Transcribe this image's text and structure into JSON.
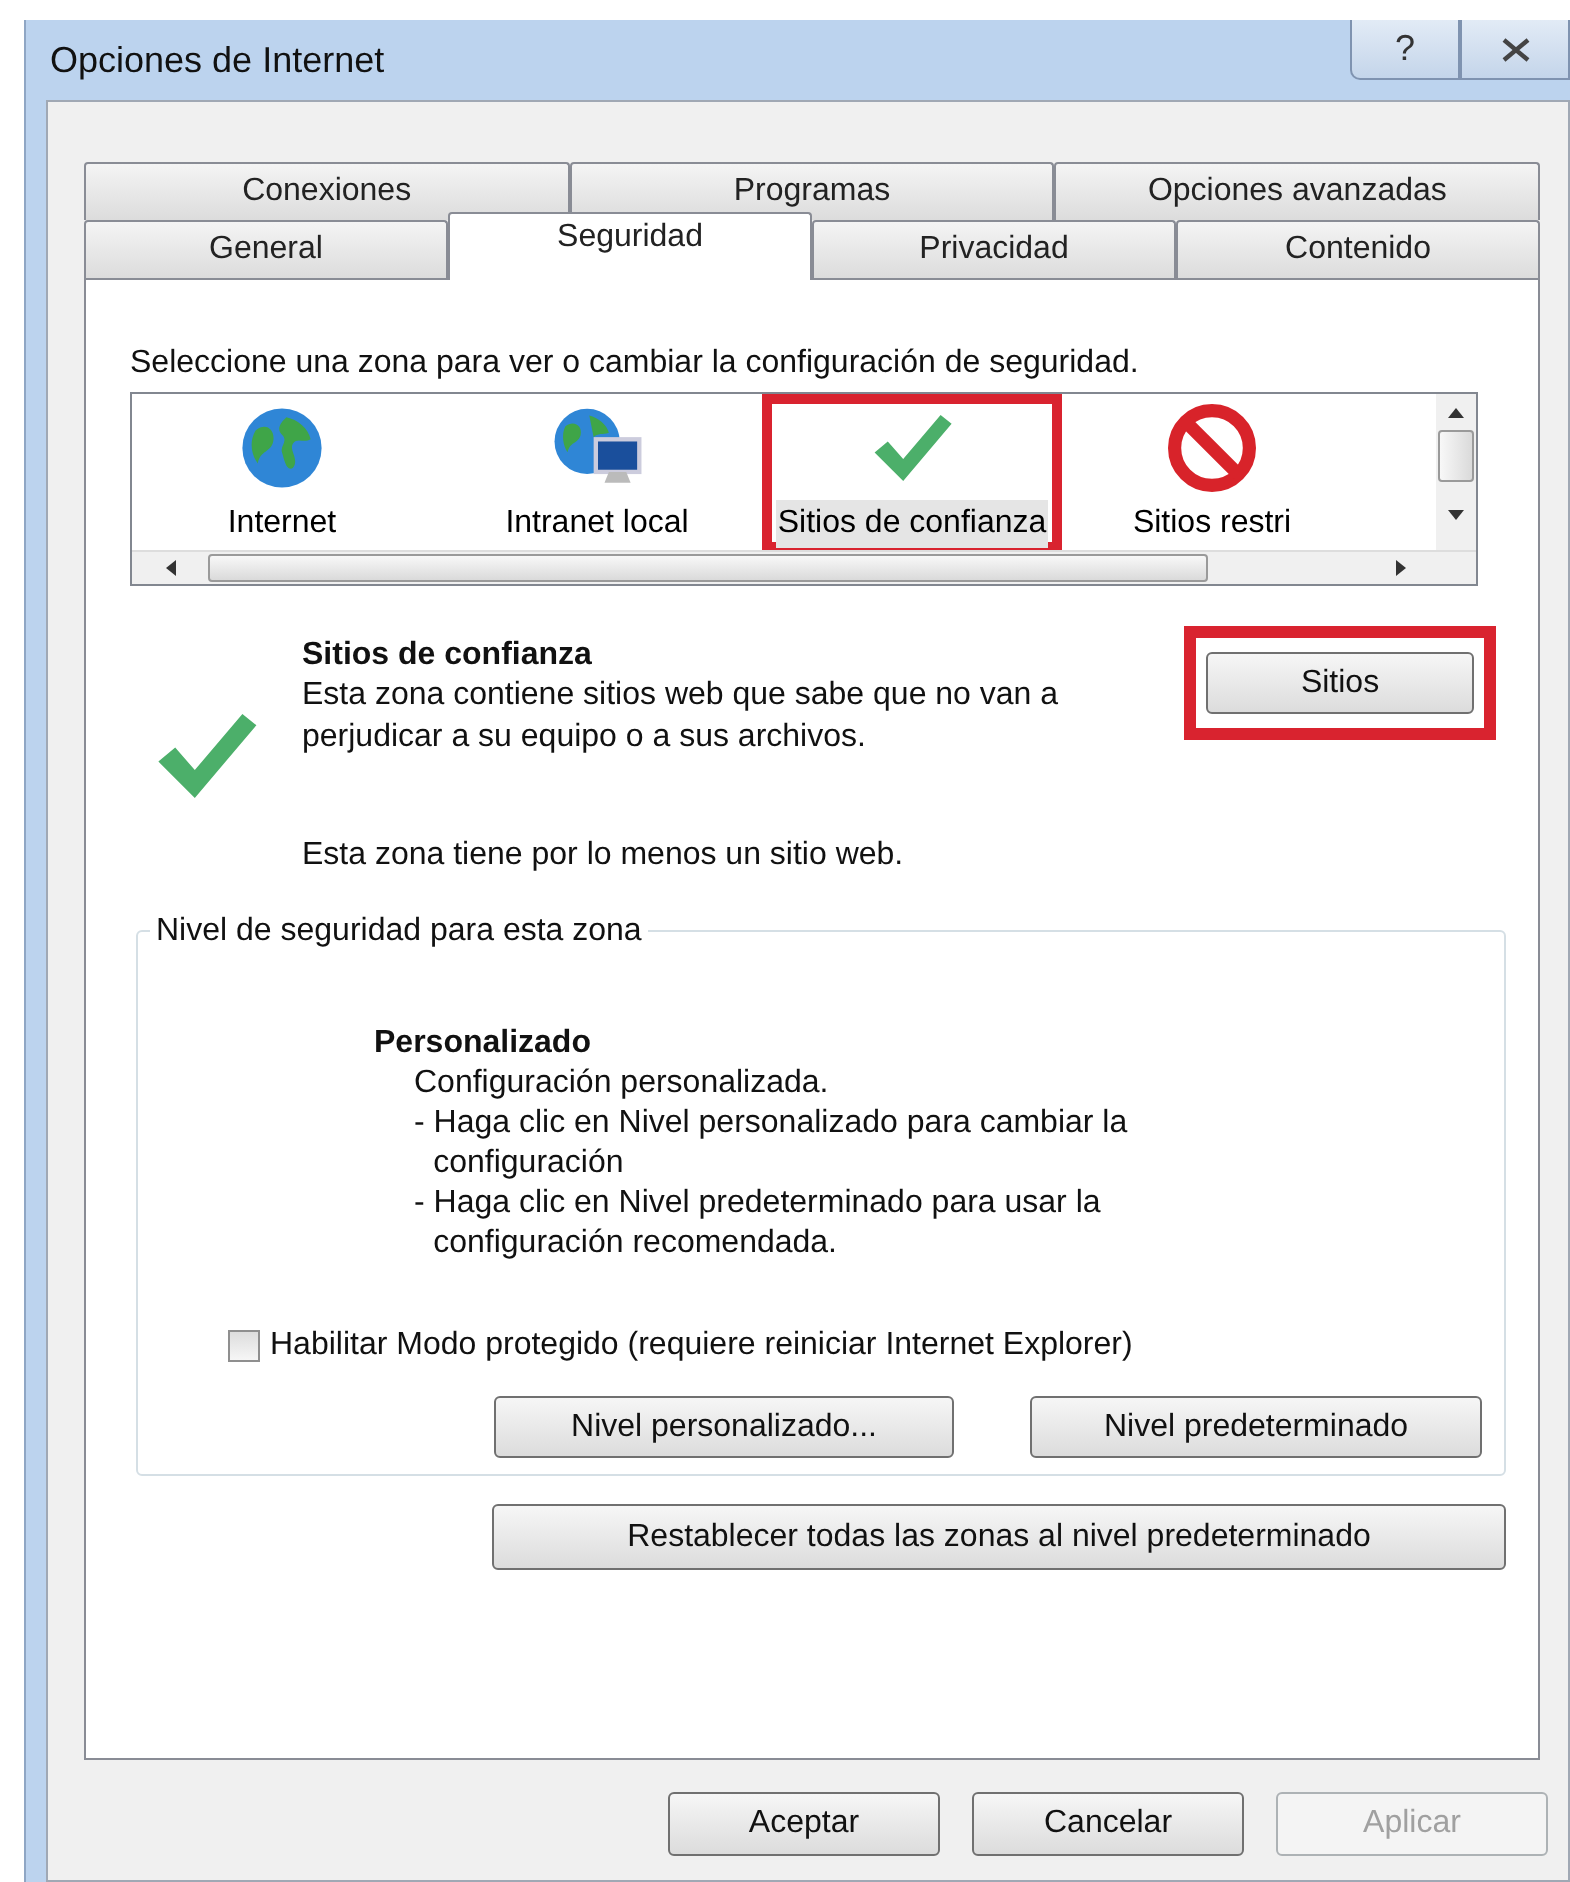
{
  "window": {
    "title": "Opciones de Internet",
    "help_button": "?"
  },
  "tab_rows": [
    [
      {
        "label": "Conexiones",
        "selected": false
      },
      {
        "label": "Programas",
        "selected": false
      },
      {
        "label": "Opciones avanzadas",
        "selected": false
      }
    ],
    [
      {
        "label": "General",
        "selected": false
      },
      {
        "label": "Seguridad",
        "selected": true
      },
      {
        "label": "Privacidad",
        "selected": false
      },
      {
        "label": "Contenido",
        "selected": false
      }
    ]
  ],
  "zone_prompt": "Seleccione una zona para ver o cambiar la configuración de seguridad.",
  "zones": [
    {
      "label": "Internet",
      "kind": "globe",
      "selected": false,
      "highlighted": false
    },
    {
      "label": "Intranet local",
      "kind": "intranet",
      "selected": false,
      "highlighted": false
    },
    {
      "label": "Sitios de confianza",
      "kind": "trusted",
      "selected": true,
      "highlighted": true
    },
    {
      "label": "Sitios restri",
      "kind": "restricted",
      "selected": false,
      "highlighted": false
    }
  ],
  "zone_detail": {
    "title": "Sitios de confianza",
    "description": "Esta zona contiene sitios web que sabe que no van a perjudicar a su equipo o a sus archivos.",
    "sites_button": {
      "label": "Sitios",
      "highlighted": true
    },
    "note": "Esta zona tiene por lo menos un sitio web."
  },
  "security_level": {
    "legend": "Nivel de seguridad para esta zona",
    "title": "Personalizado",
    "lines": [
      "Configuración personalizada.",
      "- Haga clic en Nivel personalizado para cambiar la configuración",
      "- Haga clic en Nivel predeterminado para usar la configuración recomendada."
    ],
    "protected_mode": {
      "label": "Habilitar Modo protegido (requiere reiniciar Internet Explorer)",
      "checked": false
    },
    "buttons": [
      {
        "label": "Nivel personalizado..."
      },
      {
        "label": "Nivel predeterminado"
      }
    ]
  },
  "reset_button": "Restablecer todas las zonas al nivel predeterminado",
  "dialog_buttons": [
    {
      "label": "Aceptar",
      "disabled": false
    },
    {
      "label": "Cancelar",
      "disabled": false
    },
    {
      "label": "Aplicar",
      "disabled": true
    }
  ]
}
